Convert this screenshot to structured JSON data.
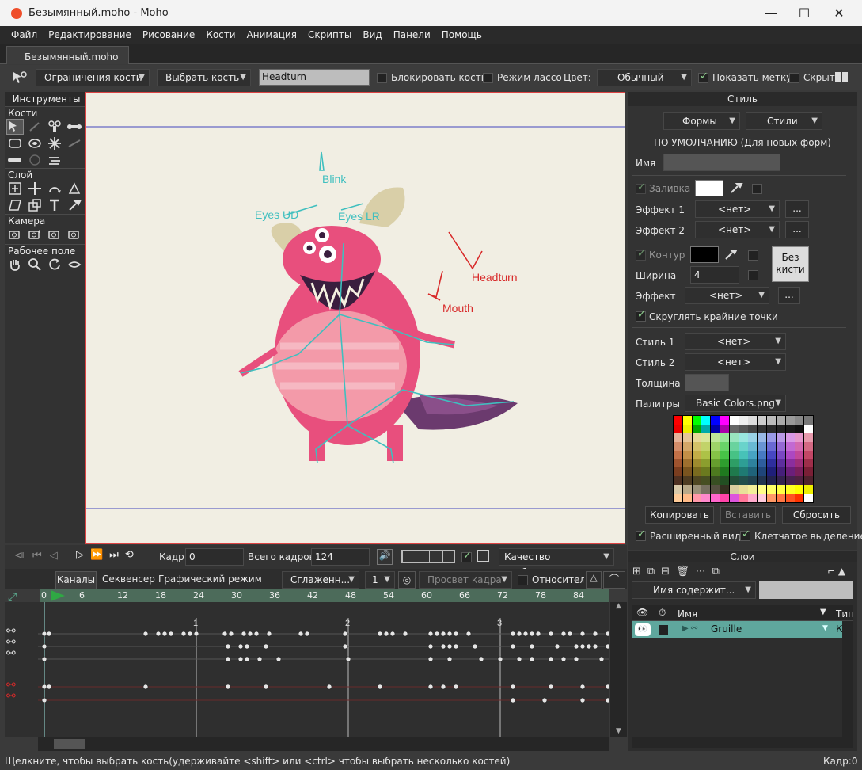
{
  "window": {
    "title": "Безымянный.moho - Moho",
    "doc_tab": "Безымянный.moho"
  },
  "menu": [
    "Файл",
    "Редактирование",
    "Рисование",
    "Кости",
    "Анимация",
    "Скрипты",
    "Вид",
    "Панели",
    "Помощь"
  ],
  "toolbar": {
    "bone_constraints": "Ограничения кости",
    "select_bone": "Выбрать кость",
    "bone_name": "Headturn",
    "lock_bone": "Блокировать кость",
    "lasso_mode": "Режим лассо",
    "color_label": "Цвет:",
    "color_value": "Обычный",
    "show_label": "Показать метку",
    "hidden": "Скрытн"
  },
  "tools": {
    "header": "Инструменты",
    "sections": [
      "Кости",
      "Слой",
      "Камера",
      "Рабочее поле"
    ]
  },
  "canvas": {
    "bone_labels": [
      "Blink",
      "Eyes UD",
      "Eyes LR",
      "Headturn",
      "Mouth"
    ]
  },
  "style_panel": {
    "title": "Стиль",
    "shapes": "Формы",
    "styles": "Стили",
    "default_text": "ПО УМОЛЧАНИЮ (Для новых форм)",
    "name_label": "Имя",
    "fill_label": "Заливка",
    "effect1_label": "Эффект 1",
    "effect2_label": "Эффект 2",
    "none": "<нет>",
    "ellipsis": "...",
    "stroke_label": "Контур",
    "no_brush": "Без кисти",
    "width_label": "Ширина",
    "width_value": "4",
    "effect_label": "Эффект",
    "round_caps": "Скруглять крайние точки",
    "style1_label": "Стиль 1",
    "style2_label": "Стиль 2",
    "thickness_label": "Толщина",
    "palette_label": "Палитры",
    "palette_value": "Basic Colors.png",
    "copy": "Копировать",
    "paste": "Вставить",
    "reset": "Сбросить",
    "advanced": "Расширенный вид",
    "cell_select": "Клетчатое выделение",
    "fill_color": "#ffffff",
    "stroke_color": "#000000"
  },
  "timeline": {
    "frame_label": "Кадр:",
    "frame_value": "0",
    "total_label": "Всего кадров:",
    "total_value": "124",
    "quality": "Качество отображения",
    "tabs": [
      "Каналы",
      "Секвенсер",
      "Графический режим"
    ],
    "smoothing": "Сглаженн...",
    "step": "1",
    "onion": "Просвет кадра",
    "relative": "Относитель",
    "ruler_ticks": [
      "0",
      "6",
      "12",
      "18",
      "24",
      "30",
      "36",
      "42",
      "48",
      "54",
      "60",
      "66",
      "72",
      "78",
      "84"
    ],
    "second_marks": [
      "1",
      "2",
      "3"
    ]
  },
  "layers": {
    "title": "Слои",
    "filter": "Имя содержит...",
    "col_name": "Имя",
    "col_type": "Тип",
    "layer_name": "Gruille",
    "layer_type": "К"
  },
  "status": {
    "text": "Щелкните, чтобы выбрать кость(удерживайте <shift> или <ctrl> чтобы выбрать несколько костей)",
    "frame": "Кадр:0"
  }
}
